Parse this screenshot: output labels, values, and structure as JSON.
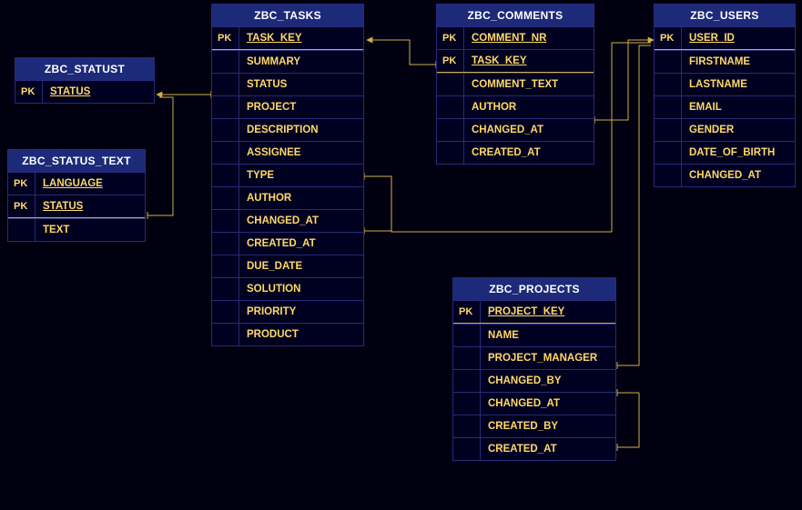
{
  "colors": {
    "background": "#000010",
    "entity_border": "#2a2a7a",
    "entity_header_bg": "#1d2a7a",
    "entity_header_fg": "#ffffff",
    "field_fg": "#ffd966",
    "pk_divider": "#d1b04a",
    "connector": "#d1b04a"
  },
  "entities": {
    "statust": {
      "title": "ZBC_STATUST",
      "keys": [
        {
          "pk": "PK",
          "name": "STATUS"
        }
      ],
      "cols": []
    },
    "status_text": {
      "title": "ZBC_STATUS_TEXT",
      "keys": [
        {
          "pk": "PK",
          "name": "LANGUAGE"
        },
        {
          "pk": "PK",
          "name": "STATUS"
        }
      ],
      "cols": [
        {
          "pk": "",
          "name": "TEXT"
        }
      ]
    },
    "tasks": {
      "title": "ZBC_TASKS",
      "keys": [
        {
          "pk": "PK",
          "name": "TASK_KEY"
        }
      ],
      "cols": [
        {
          "pk": "",
          "name": "SUMMARY"
        },
        {
          "pk": "",
          "name": "STATUS"
        },
        {
          "pk": "",
          "name": "PROJECT"
        },
        {
          "pk": "",
          "name": "DESCRIPTION"
        },
        {
          "pk": "",
          "name": "ASSIGNEE"
        },
        {
          "pk": "",
          "name": "TYPE"
        },
        {
          "pk": "",
          "name": "AUTHOR"
        },
        {
          "pk": "",
          "name": "CHANGED_AT"
        },
        {
          "pk": "",
          "name": "CREATED_AT"
        },
        {
          "pk": "",
          "name": "DUE_DATE"
        },
        {
          "pk": "",
          "name": "SOLUTION"
        },
        {
          "pk": "",
          "name": "PRIORITY"
        },
        {
          "pk": "",
          "name": "PRODUCT"
        }
      ]
    },
    "comments": {
      "title": "ZBC_COMMENTS",
      "keys": [
        {
          "pk": "PK",
          "name": "COMMENT_NR"
        },
        {
          "pk": "PK",
          "name": "TASK_KEY"
        }
      ],
      "cols": [
        {
          "pk": "",
          "name": "COMMENT_TEXT"
        },
        {
          "pk": "",
          "name": "AUTHOR"
        },
        {
          "pk": "",
          "name": "CHANGED_AT"
        },
        {
          "pk": "",
          "name": "CREATED_AT"
        }
      ]
    },
    "users": {
      "title": "ZBC_USERS",
      "keys": [
        {
          "pk": "PK",
          "name": "USER_ID"
        }
      ],
      "cols": [
        {
          "pk": "",
          "name": "FIRSTNAME"
        },
        {
          "pk": "",
          "name": "LASTNAME"
        },
        {
          "pk": "",
          "name": "EMAIL"
        },
        {
          "pk": "",
          "name": "GENDER"
        },
        {
          "pk": "",
          "name": "DATE_OF_BIRTH"
        },
        {
          "pk": "",
          "name": "CHANGED_AT"
        }
      ]
    },
    "projects": {
      "title": "ZBC_PROJECTS",
      "keys": [
        {
          "pk": "PK",
          "name": "PROJECT_KEY"
        }
      ],
      "cols": [
        {
          "pk": "",
          "name": "NAME"
        },
        {
          "pk": "",
          "name": "PROJECT_MANAGER"
        },
        {
          "pk": "",
          "name": "CHANGED_BY"
        },
        {
          "pk": "",
          "name": "CHANGED_AT"
        },
        {
          "pk": "",
          "name": "CREATED_BY"
        },
        {
          "pk": "",
          "name": "CREATED_AT"
        }
      ]
    }
  },
  "relationships": [
    {
      "from": "ZBC_TASKS.STATUS",
      "to": "ZBC_STATUST.STATUS"
    },
    {
      "from": "ZBC_STATUS_TEXT.STATUS",
      "to": "ZBC_STATUST.STATUS"
    },
    {
      "from": "ZBC_COMMENTS.TASK_KEY",
      "to": "ZBC_TASKS.TASK_KEY"
    },
    {
      "from": "ZBC_COMMENTS.AUTHOR",
      "to": "ZBC_USERS.USER_ID"
    },
    {
      "from": "ZBC_TASKS.ASSIGNEE",
      "to": "ZBC_USERS.USER_ID"
    },
    {
      "from": "ZBC_TASKS.AUTHOR",
      "to": "ZBC_USERS.USER_ID"
    },
    {
      "from": "ZBC_PROJECTS.PROJECT_MANAGER",
      "to": "ZBC_USERS.USER_ID"
    },
    {
      "from": "ZBC_PROJECTS.CHANGED_BY",
      "to": "ZBC_USERS.USER_ID"
    },
    {
      "from": "ZBC_PROJECTS.CREATED_BY",
      "to": "ZBC_USERS.USER_ID"
    }
  ]
}
